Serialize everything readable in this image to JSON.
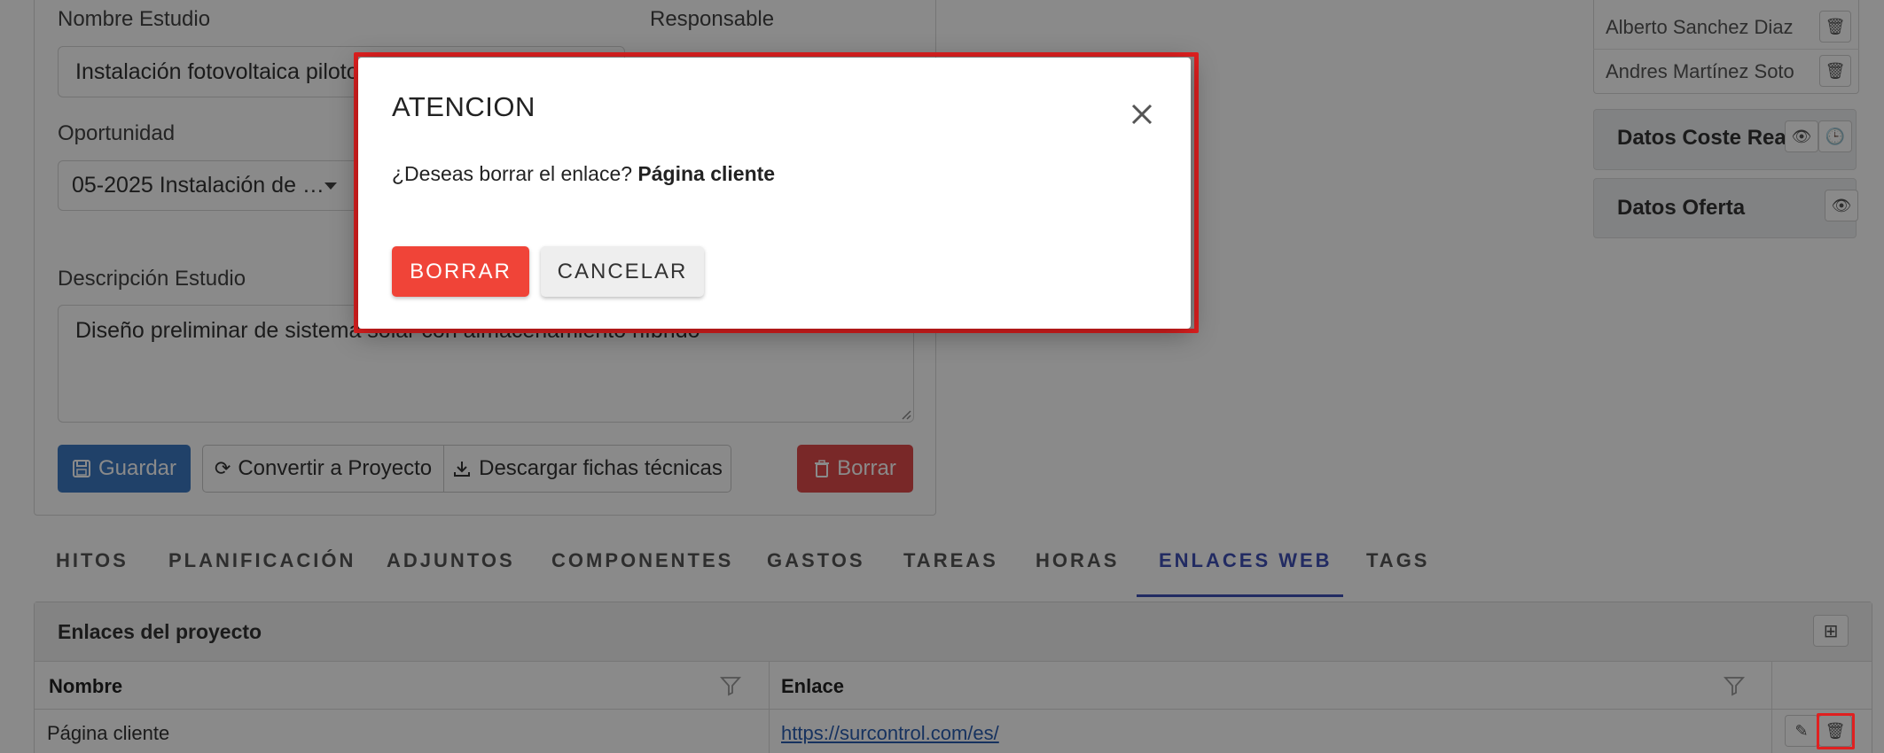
{
  "form": {
    "nombre_label": "Nombre Estudio",
    "nombre_value": "Instalación fotovoltaica piloto",
    "responsable_label": "Responsable",
    "oportunidad_label": "Oportunidad",
    "oportunidad_value": "05-2025 Instalación de …",
    "descripcion_label": "Descripción Estudio",
    "descripcion_value": "Diseño preliminar de sistema solar con almacenamiento híbrido"
  },
  "actions": {
    "guardar": "Guardar",
    "convertir": "Convertir a Proyecto",
    "descargar": "Descargar fichas técnicas",
    "borrar": "Borrar"
  },
  "responsables": [
    "Alberto Sanchez Diaz",
    "Andres Martínez Soto"
  ],
  "side_cards": {
    "coste_real": "Datos Coste Real",
    "oferta": "Datos Oferta"
  },
  "tabs": [
    {
      "label": "HITOS"
    },
    {
      "label": "PLANIFICACIÓN"
    },
    {
      "label": "ADJUNTOS"
    },
    {
      "label": "COMPONENTES"
    },
    {
      "label": "GASTOS"
    },
    {
      "label": "TAREAS"
    },
    {
      "label": "HORAS"
    },
    {
      "label": "ENLACES WEB",
      "active": true
    },
    {
      "label": "TAGS"
    }
  ],
  "links_panel": {
    "title": "Enlaces del proyecto",
    "col_nombre": "Nombre",
    "col_enlace": "Enlace",
    "rows": [
      {
        "nombre": "Página cliente",
        "enlace": "https://surcontrol.com/es/"
      }
    ]
  },
  "modal": {
    "title": "ATENCION",
    "message": "¿Deseas borrar el enlace?",
    "item_name": "Página cliente",
    "confirm_label": "BORRAR",
    "cancel_label": "CANCELAR"
  },
  "colors": {
    "primary": "#3b78c3",
    "danger": "#f04438",
    "tab_active": "#3f51b5",
    "highlight": "#e02020"
  }
}
